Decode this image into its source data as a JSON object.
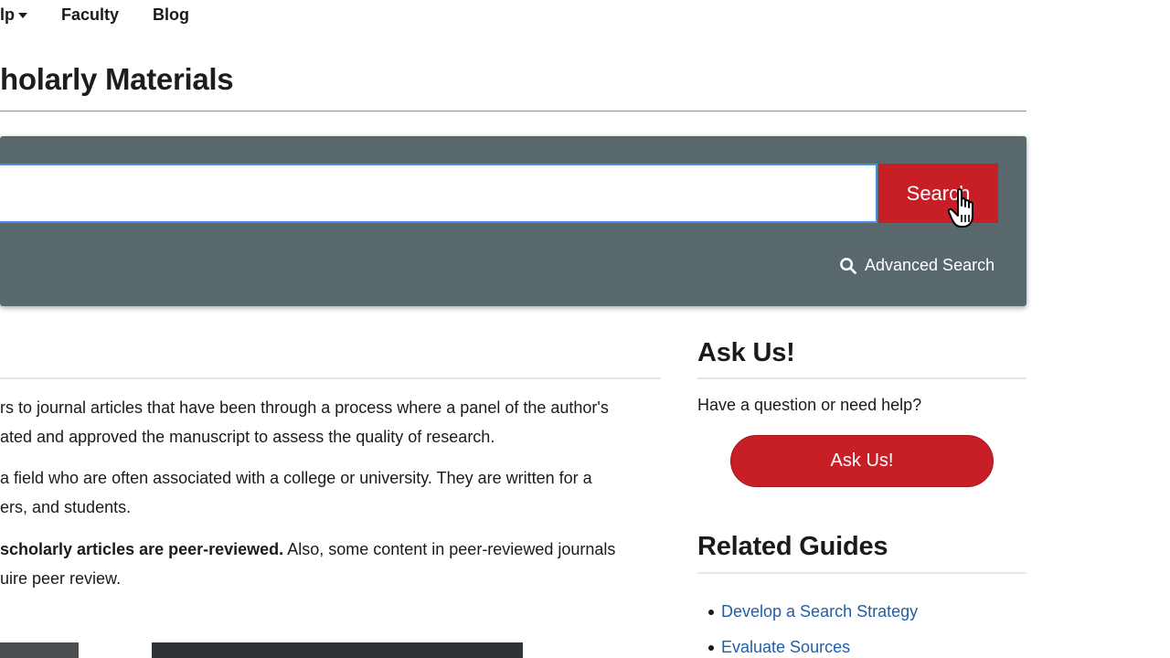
{
  "nav": {
    "help_label": "lp",
    "faculty_label": "Faculty",
    "blog_label": "Blog"
  },
  "page": {
    "title": "holarly Materials"
  },
  "search": {
    "input_value": "",
    "button_label": "Search",
    "advanced_label": "Advanced Search"
  },
  "content": {
    "p1_line1": "rs to journal articles that have been through a process where a panel of the author's",
    "p1_line2": "ated and approved the manuscript to assess the quality of research.",
    "p2_line1": "a field who are often associated with a college or university. They are written for a",
    "p2_line2": "ers, and students.",
    "p3_bold": "scholarly articles are peer-reviewed.",
    "p3_rest": " Also, some content in peer-reviewed journals",
    "p3_line2": "uire peer review."
  },
  "sidebar": {
    "ask_heading": "Ask Us!",
    "ask_text": "Have a question or need help?",
    "ask_button": "Ask Us!",
    "related_heading": "Related Guides",
    "related_items": [
      {
        "label": "Develop a Search Strategy"
      },
      {
        "label": "Evaluate Sources"
      }
    ]
  },
  "colors": {
    "accent_red": "#c71f25",
    "panel_gray": "#58686d",
    "link_blue": "#1f5fa8"
  },
  "icons": {
    "advanced_search": "search-icon",
    "cursor": "hand-pointer-icon",
    "nav_caret": "caret-down-icon"
  }
}
